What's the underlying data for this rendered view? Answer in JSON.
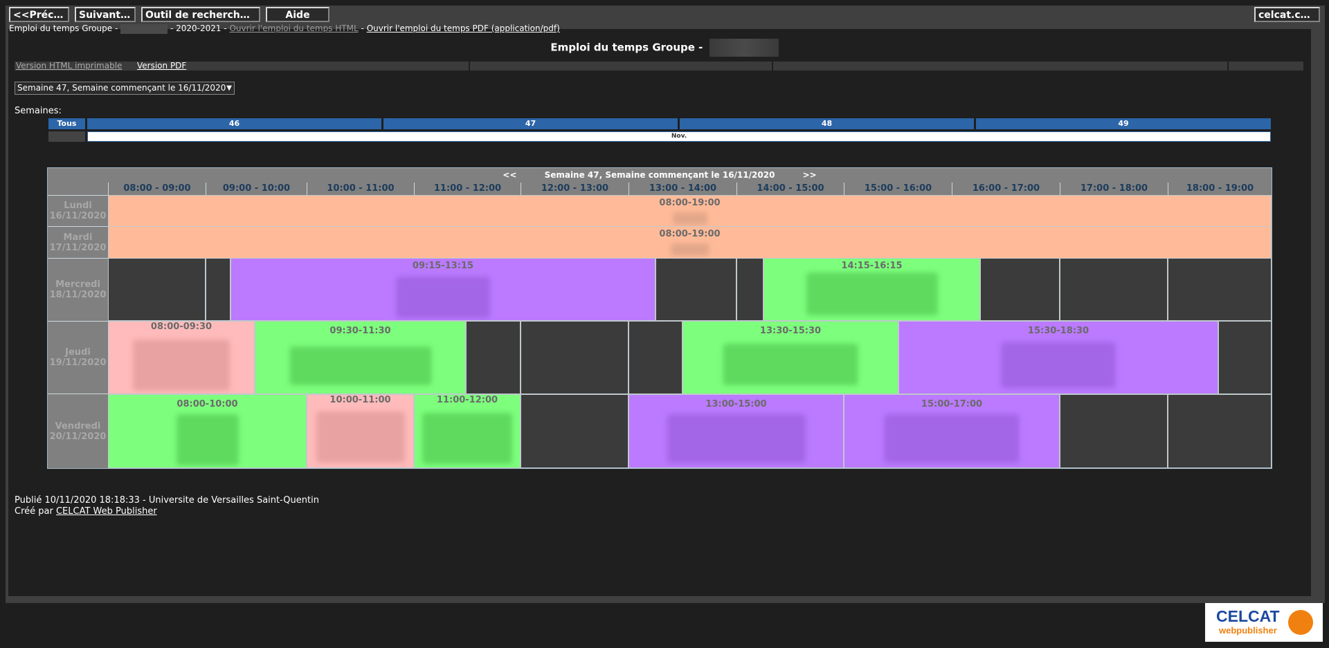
{
  "toolbar": {
    "prev": "<<Précéd...",
    "next": "Suivant>>",
    "search": "Outil de recherche d'e...",
    "help": "Aide",
    "site": "celcat.com"
  },
  "breadcrumb": {
    "prefix": "Emploi du temps Groupe -",
    "year": "- 2020-2021 -",
    "html_link": "Ouvrir l'emploi du temps HTML",
    "sep": "-",
    "pdf_link": "Ouvrir l'emploi du temps PDF (application/pdf)"
  },
  "page_title": "Emploi du temps Groupe -",
  "subnav": {
    "printable": "Version HTML imprimable",
    "pdf": "Version PDF"
  },
  "week_select": {
    "value": "Semaine 47, Semaine commençant le 16/11/2020"
  },
  "weeks": {
    "label": "Semaines:",
    "all": "Tous",
    "items": [
      "46",
      "47",
      "48",
      "49"
    ],
    "month": "Nov."
  },
  "timetable": {
    "prev": "<<",
    "title": "Semaine 47, Semaine commençant le 16/11/2020",
    "next": ">>",
    "time_columns": [
      "08:00 - 09:00",
      "09:00 - 10:00",
      "10:00 - 11:00",
      "11:00 - 12:00",
      "12:00 - 13:00",
      "13:00 - 14:00",
      "14:00 - 15:00",
      "15:00 - 16:00",
      "16:00 - 17:00",
      "17:00 - 18:00",
      "18:00 - 19:00"
    ],
    "days": [
      {
        "name": "Lundi",
        "date": "16/11/2020"
      },
      {
        "name": "Mardi",
        "date": "17/11/2020"
      },
      {
        "name": "Mercredi",
        "date": "18/11/2020"
      },
      {
        "name": "Jeudi",
        "date": "19/11/2020"
      },
      {
        "name": "Vendredi",
        "date": "20/11/2020"
      }
    ],
    "events": {
      "lun": "08:00-19:00",
      "mar": "08:00-19:00",
      "mer1": "09:15-13:15",
      "mer2": "14:15-16:15",
      "jeu1": "08:00-09:30",
      "jeu2": "09:30-11:30",
      "jeu3": "13:30-15:30",
      "jeu4": "15:30-18:30",
      "ven1": "08:00-10:00",
      "ven2": "10:00-11:00",
      "ven3": "11:00-12:00",
      "ven4": "13:00-15:00",
      "ven5": "15:00-17:00"
    },
    "colors": {
      "orange": "#ffbb99",
      "purple": "#bb7aff",
      "green": "#7dff7d",
      "pink": "#ffbbbb"
    }
  },
  "footer": {
    "published": "Publié 10/11/2020 18:18:33 - Universite de Versailles Saint-Quentin",
    "created_prefix": "Créé par",
    "created_link": "CELCAT Web Publisher"
  },
  "logo": {
    "line1": "CELCAT",
    "line2": "webpublisher"
  }
}
